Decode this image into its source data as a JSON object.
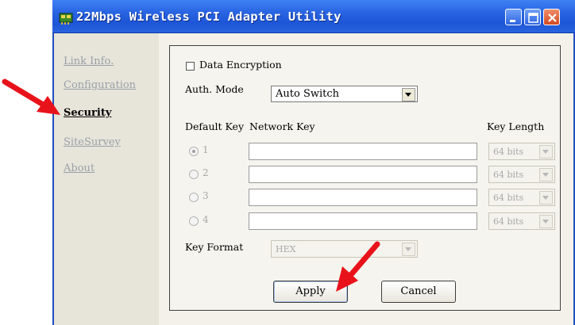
{
  "window": {
    "title": "22Mbps Wireless PCI Adapter Utility"
  },
  "sidebar": {
    "items": [
      {
        "label": "Link Info.",
        "active": false
      },
      {
        "label": "Configuration",
        "active": false
      },
      {
        "label": "Security",
        "active": true
      },
      {
        "label": "SiteSurvey",
        "active": false
      },
      {
        "label": "About",
        "active": false
      }
    ]
  },
  "security": {
    "data_encryption_label": "Data Encryption",
    "data_encryption_checked": false,
    "auth_mode_label": "Auth. Mode",
    "auth_mode_value": "Auto Switch",
    "default_key_header": "Default Key",
    "network_key_header": "Network Key",
    "key_length_header": "Key Length",
    "keys": [
      {
        "number": "1",
        "selected": true,
        "value": "",
        "length": "64 bits"
      },
      {
        "number": "2",
        "selected": false,
        "value": "",
        "length": "64 bits"
      },
      {
        "number": "3",
        "selected": false,
        "value": "",
        "length": "64 bits"
      },
      {
        "number": "4",
        "selected": false,
        "value": "",
        "length": "64 bits"
      }
    ],
    "key_format_label": "Key Format",
    "key_format_value": "HEX"
  },
  "buttons": {
    "apply": "Apply",
    "cancel": "Cancel"
  },
  "colors": {
    "titlebar": "#2a66e4",
    "arrow": "#e8121a",
    "sidebar_bg": "#e7e5da",
    "panel_bg": "#f5f4ee"
  }
}
